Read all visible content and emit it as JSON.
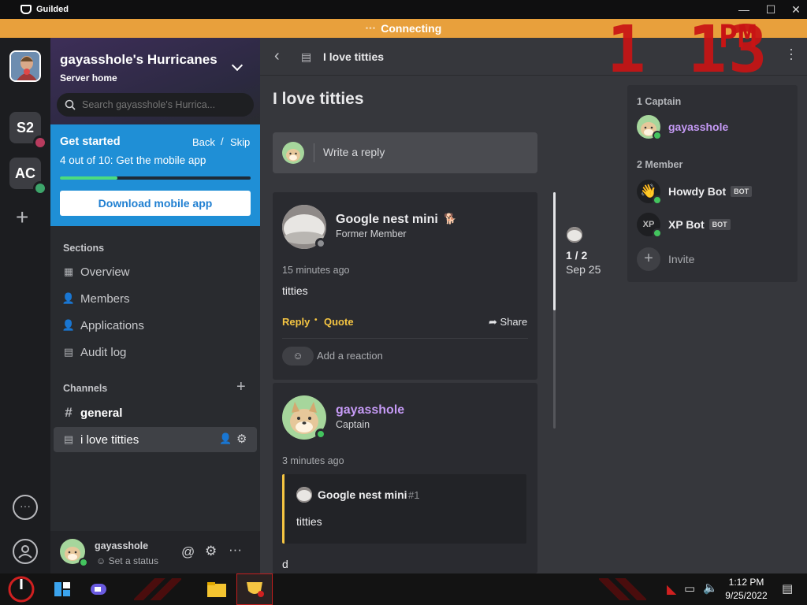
{
  "window": {
    "app_name": "Guilded",
    "minimize": "—",
    "maximize": "☐",
    "close": "✕"
  },
  "connection": {
    "status": "Connecting",
    "dots": "•••"
  },
  "clock_overlay": {
    "time": "1 13",
    "ampm": "PM"
  },
  "rail": {
    "servers": [
      {
        "label": "S2"
      },
      {
        "label": "AC"
      }
    ],
    "add": "+"
  },
  "server": {
    "name": "gayasshole's Hurricanes",
    "subtitle": "Server home",
    "search_placeholder": "Search gayasshole's Hurrica..."
  },
  "get_started": {
    "title": "Get started",
    "back": "Back",
    "slash": "/",
    "skip": "Skip",
    "progress_text": "4 out of 10: Get the mobile app",
    "progress": 0.3,
    "button": "Download mobile app"
  },
  "sections": {
    "header": "Sections",
    "items": [
      {
        "label": "Overview",
        "icon": "grid-icon"
      },
      {
        "label": "Members",
        "icon": "members-icon"
      },
      {
        "label": "Applications",
        "icon": "applications-icon"
      },
      {
        "label": "Audit log",
        "icon": "clipboard-icon"
      }
    ]
  },
  "channels": {
    "header": "Channels",
    "add": "+",
    "items": [
      {
        "label": "general",
        "icon": "#"
      },
      {
        "label": "i love titties",
        "icon": "list-icon"
      }
    ]
  },
  "user": {
    "name": "gayasshole",
    "status": "Set a status"
  },
  "thread": {
    "title_small": "I love titties",
    "title": "I love titties",
    "reply_placeholder": "Write a reply"
  },
  "posts": [
    {
      "author": "Google nest mini",
      "role": "Former Member",
      "time": "15 minutes ago",
      "body": "titties",
      "reply": "Reply",
      "sep": "•",
      "quote": "Quote",
      "share": "Share",
      "reaction": "Add a reaction"
    },
    {
      "author": "gayasshole",
      "role": "Captain",
      "time": "3 minutes ago",
      "quoted_author": "Google nest mini",
      "quoted_num": "#1",
      "quoted_body": "titties",
      "body": "d"
    }
  ],
  "timeline": {
    "position": "1 / 2",
    "date": "Sep 25"
  },
  "members": {
    "captain_header": "1 Captain",
    "member_header": "2 Member",
    "captain": {
      "name": "gayasshole",
      "color": "#c59af5"
    },
    "list": [
      {
        "name": "Howdy Bot",
        "badge": "BOT"
      },
      {
        "name": "XP Bot",
        "badge": "BOT"
      }
    ],
    "invite": "Invite"
  },
  "taskbar": {
    "time": "1:12 PM",
    "date": "9/25/2022"
  },
  "colors": {
    "accent": "#1f8fd6",
    "connecting": "#e8a03c",
    "online": "#43c45e",
    "captain_name": "#c59af5",
    "action_yellow": "#f5c542"
  }
}
